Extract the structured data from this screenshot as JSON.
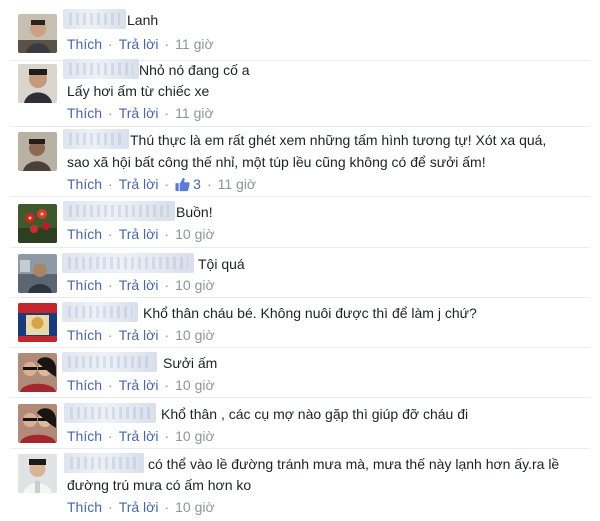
{
  "action_labels": {
    "like": "Thích",
    "reply": "Trả lời",
    "separator": "·"
  },
  "comments": [
    {
      "text_lines": [
        "Lanh"
      ],
      "time": "11 giờ",
      "avatar_icon": "avatar-man-photo-icon"
    },
    {
      "text_lines": [
        "Nhỏ nó đang cố a",
        "Lấy hơi ấm từ chiếc xe"
      ],
      "time": "11 giờ",
      "avatar_icon": "avatar-man-photo-icon"
    },
    {
      "text_lines": [
        "Thú thực là em rất ghét xem những tấm hình tương tự! Xót xa quá,",
        "sao xã hội bất công thế nhỉ, một túp lều cũng không có để sưởi ấm!"
      ],
      "time": "11 giờ",
      "like_count": "3",
      "avatar_icon": "avatar-man-photo-icon"
    },
    {
      "text_lines": [
        "Buồn!"
      ],
      "time": "10 giờ",
      "avatar_icon": "avatar-red-flowers-icon"
    },
    {
      "text_lines": [
        "Tội quá"
      ],
      "time": "10 giờ",
      "avatar_icon": "avatar-photo-icon"
    },
    {
      "text_lines": [
        "Khổ thân cháu bé. Không nuôi được thì để làm j chứ?"
      ],
      "time": "10 giờ",
      "avatar_icon": "avatar-poster-icon"
    },
    {
      "text_lines": [
        "Sưởi ấm"
      ],
      "time": "10 giờ",
      "avatar_icon": "avatar-couple-photo-icon"
    },
    {
      "text_lines": [
        "Khổ thân , các cụ mợ nào gặp thì giúp đỡ cháu đi"
      ],
      "time": "10 giờ",
      "avatar_icon": "avatar-couple-photo-icon"
    },
    {
      "text_lines": [
        "có thể vào lề đường tránh mưa mà, mưa thế này lạnh hơn ấy.ra lề",
        "đường trú mưa có ấm hơn ko"
      ],
      "time": "10 giờ",
      "avatar_icon": "avatar-man-photo-icon"
    }
  ],
  "colors": {
    "link": "#4b67a1",
    "meta": "#90949c",
    "text": "#1d2129"
  }
}
